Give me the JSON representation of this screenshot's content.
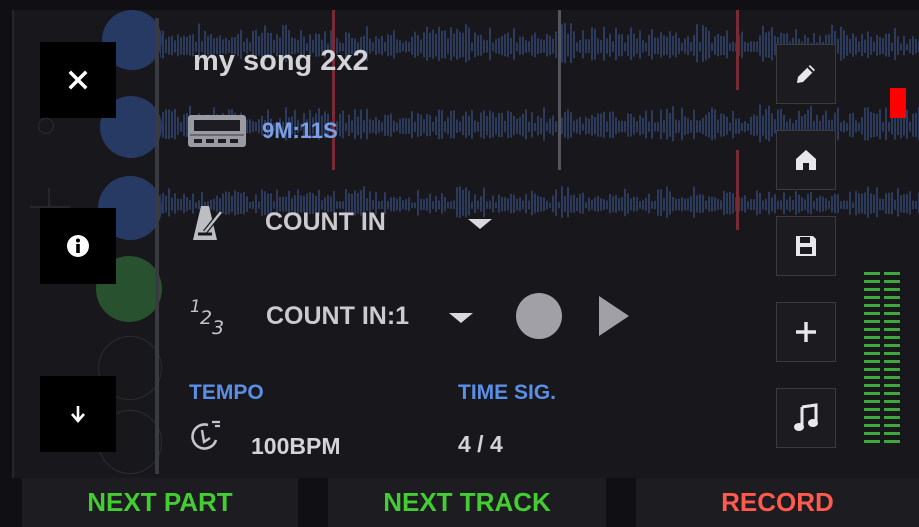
{
  "song": {
    "title": "my song 2x2",
    "duration": "9M:11S"
  },
  "count_in": {
    "mode_label": "COUNT IN",
    "count_label": "COUNT IN:1"
  },
  "tempo": {
    "label": "TEMPO",
    "value": "100BPM"
  },
  "time_sig": {
    "label": "TIME SIG.",
    "value": "4 / 4"
  },
  "bottom": {
    "next_part": "NEXT PART",
    "next_track": "NEXT TRACK",
    "record": "RECORD"
  },
  "colors": {
    "accent_blue": "#5b8ee6",
    "next_green": "#44cc33",
    "record_red": "#ff5a4e",
    "meter_green": "#3ea83e",
    "clip_red": "#ff0000"
  },
  "icons": {
    "close": "close-icon",
    "info": "info-icon",
    "down": "arrow-down-icon",
    "edit": "pencil-icon",
    "home": "home-icon",
    "save": "floppy-disk-icon",
    "add": "plus-icon",
    "music": "music-note-icon",
    "drum_machine": "drum-machine-icon",
    "metronome": "metronome-icon",
    "count": "count-123-icon",
    "tempo": "tempo-icon",
    "record": "record-icon",
    "play": "play-icon"
  }
}
